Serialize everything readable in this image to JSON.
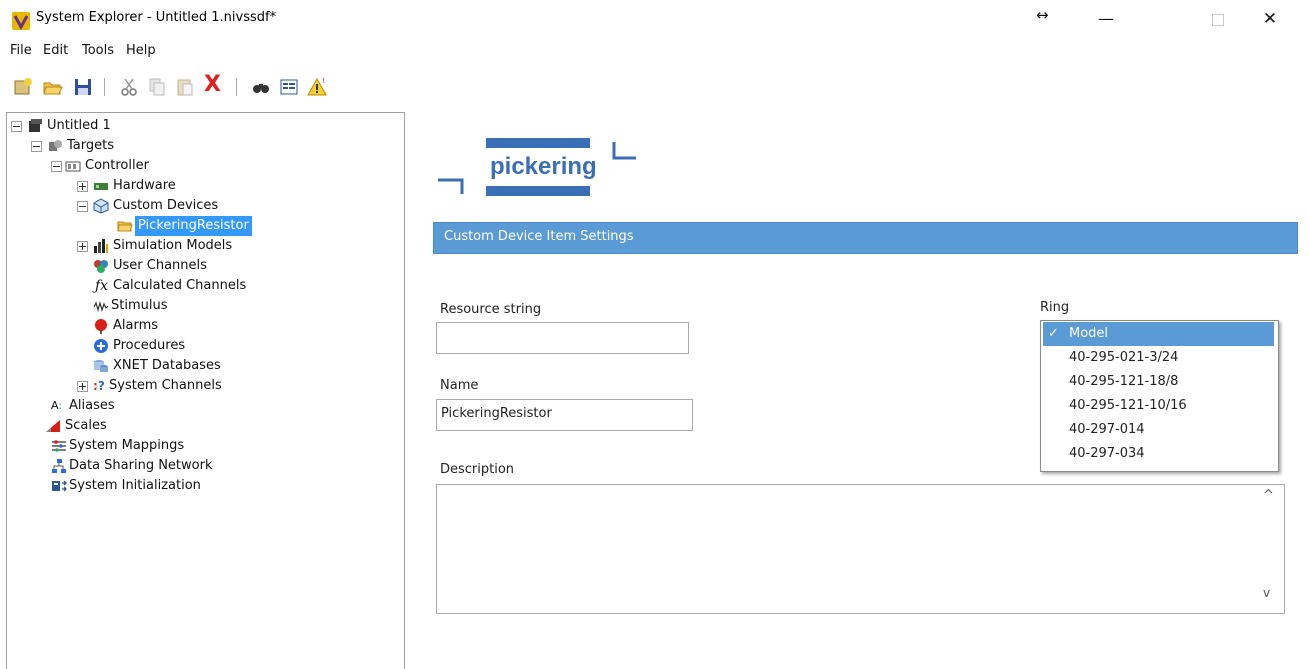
{
  "window": {
    "title": "System Explorer - Untitled 1.nivssdf*",
    "resize_glyph": "↔",
    "minimize": "—",
    "close": "✕"
  },
  "menu": [
    "File",
    "Edit",
    "Tools",
    "Help"
  ],
  "toolbar": {
    "icons": [
      "new-project-icon",
      "open-folder-icon",
      "save-icon",
      "cut-icon",
      "copy-icon",
      "paste-icon",
      "delete-icon",
      "find-icon",
      "properties-icon",
      "warning-icon"
    ],
    "delete_glyph": "X"
  },
  "tree": {
    "root": "Untitled 1",
    "targets": "Targets",
    "controller": "Controller",
    "hardware": "Hardware",
    "custom_devices": "Custom Devices",
    "pickering_resistor": "PickeringResistor",
    "simulation_models": "Simulation Models",
    "user_channels": "User Channels",
    "calculated_channels": "Calculated Channels",
    "stimulus": "Stimulus",
    "alarms": "Alarms",
    "procedures": "Procedures",
    "xnet_databases": "XNET Databases",
    "system_channels": "System Channels",
    "aliases": "Aliases",
    "scales": "Scales",
    "system_mappings": "System Mappings",
    "data_sharing_network": "Data Sharing Network",
    "system_initialization": "System Initialization"
  },
  "logo": {
    "text": "pickering",
    "color": "#3a6fb5"
  },
  "settings": {
    "header": "Custom Device Item Settings",
    "resource_label": "Resource string",
    "resource_value": "",
    "name_label": "Name",
    "name_value": "PickeringResistor",
    "description_label": "Description",
    "description_value": "",
    "ring_label": "Ring",
    "ring_options": [
      "Model",
      "40-295-021-3/24",
      "40-295-121-18/8",
      "40-295-121-10/16",
      "40-297-014",
      "40-297-034"
    ],
    "ring_selected": "Model",
    "check_glyph": "✓",
    "scroll_up": "^",
    "scroll_down": "v"
  },
  "colors": {
    "accent": "#5b9bd5",
    "selection": "#3399ff"
  }
}
